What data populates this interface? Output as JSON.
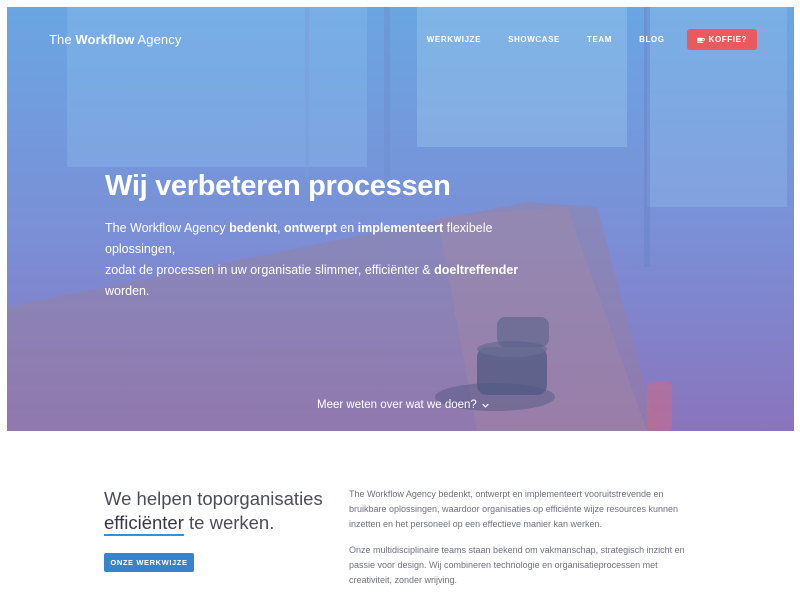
{
  "header": {
    "logo_prefix": "The ",
    "logo_bold": "Workflow",
    "logo_suffix": " Agency",
    "nav": [
      "WERKWIJZE",
      "SHOWCASE",
      "TEAM",
      "BLOG"
    ],
    "cta_label": "KOFFIE?",
    "cta_icon": "coffee-cup-icon"
  },
  "hero": {
    "title": "Wij verbeteren processen",
    "line1_a": "The Workflow Agency ",
    "line1_b": "bedenkt",
    "line1_c": ", ",
    "line1_d": "ontwerpt",
    "line1_e": " en ",
    "line1_f": "implementeert",
    "line1_g": " flexibele oplossingen,",
    "line2_a": "zodat de processen in uw organisatie slimmer, efficiënter & ",
    "line2_b": "doeltreffender",
    "line2_c": " worden.",
    "more_link": "Meer weten over wat we doen?",
    "more_icon": "chevron-down-icon"
  },
  "intro": {
    "lead_line1": "We helpen toporganisaties",
    "lead_highlight": "efficiënter",
    "lead_rest": " te werken.",
    "button": "ONZE WERKWIJZE",
    "paragraph1": "The Workflow Agency bedenkt, ontwerpt en implementeert vooruitstrevende en bruikbare oplossingen, waardoor organisaties op efficiënte wijze resources kunnen inzetten en het personeel op een effectieve manier kan werken.",
    "paragraph2": "Onze multidisciplinaire teams staan bekend om vakmanschap, strategisch inzicht en passie voor design. Wij combineren technologie en organisatieprocessen met creativiteit, zonder wrijving."
  },
  "colors": {
    "accent": "#3784cc",
    "cta_red": "#e85a5e",
    "hero_top": "#6ea5e1",
    "hero_bottom": "#8270b9"
  }
}
